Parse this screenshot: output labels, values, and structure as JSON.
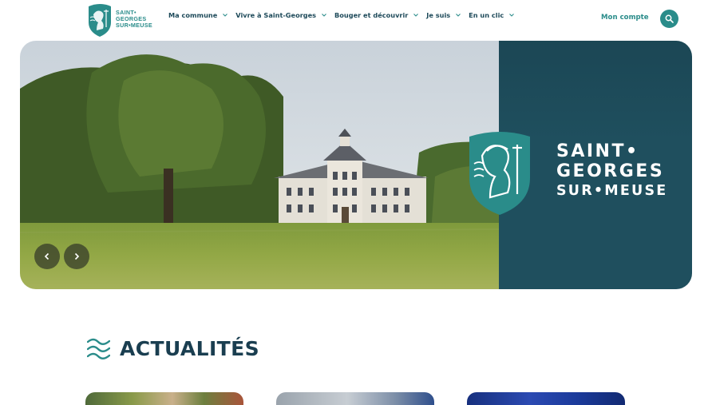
{
  "header": {
    "logo_lines": [
      "SAINT•",
      "GEORGES",
      "SUR•MEUSE"
    ],
    "nav": [
      {
        "label": "Ma commune"
      },
      {
        "label": "Vivre à Saint-Georges"
      },
      {
        "label": "Bouger et découvrir"
      },
      {
        "label": "Je suis"
      },
      {
        "label": "En un clic"
      }
    ],
    "account_label": "Mon compte",
    "search_icon": "search-icon"
  },
  "hero": {
    "title_lines": [
      "SAINT•",
      "GEORGES",
      "SUR•MEUSE"
    ],
    "prev_icon": "chevron-left-icon",
    "next_icon": "chevron-right-icon"
  },
  "news": {
    "title": "ACTUALITÉS",
    "icon": "waves-icon"
  },
  "colors": {
    "brand": "#2a8c8a",
    "navy": "#1e4a5a",
    "panel": "#1f4f5e"
  }
}
